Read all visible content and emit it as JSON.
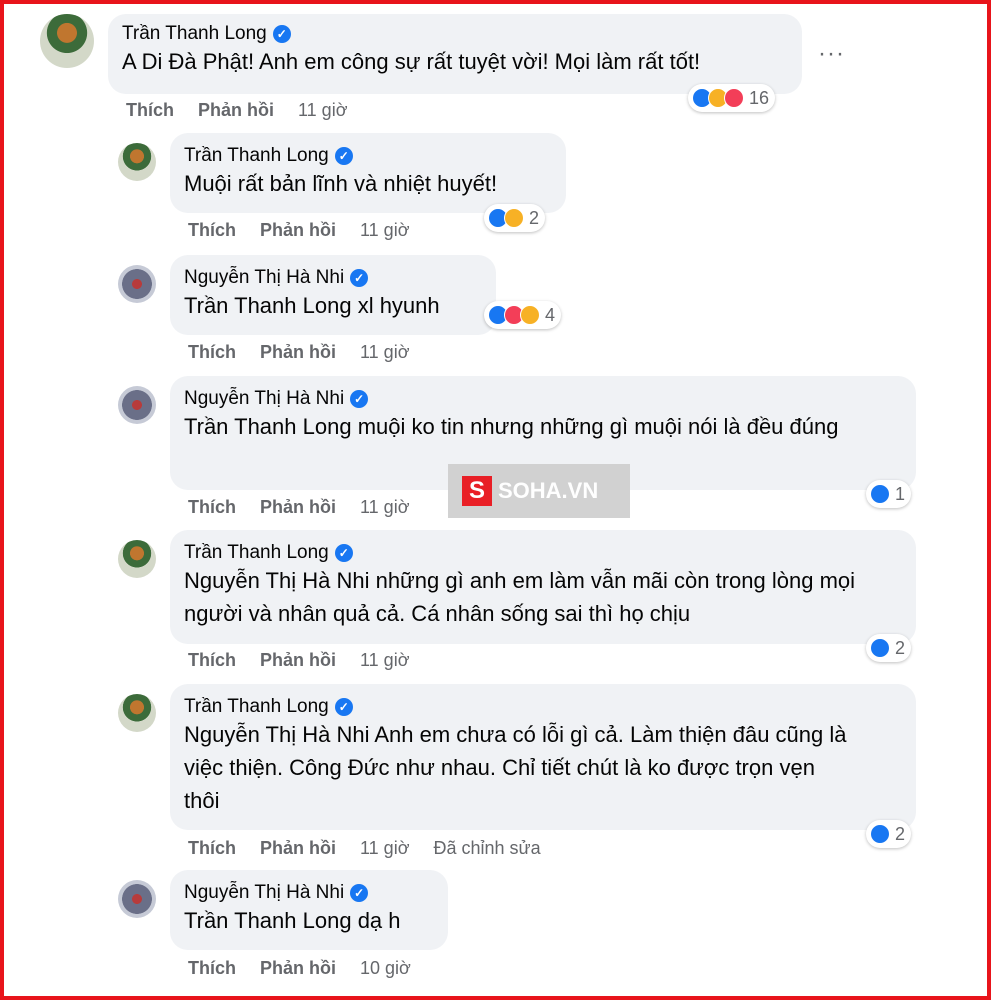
{
  "colors": {
    "border": "#e8141b",
    "bubble": "#f0f2f5",
    "meta": "#65676b",
    "like": "#1877f2"
  },
  "actions": {
    "like": "Thích",
    "reply": "Phản hồi"
  },
  "more_label": "···",
  "comments": [
    {
      "author": "Trần Thanh Long",
      "text": "A Di Đà Phật! Anh em công sự rất tuyệt vời! Mọi làm rất tốt!",
      "time": "11 giờ",
      "reactions": [
        "like",
        "care",
        "love"
      ],
      "count": "16"
    },
    {
      "author": "Trần Thanh Long",
      "text": "Muội rất bản lĩnh và nhiệt huyết!",
      "time": "11 giờ",
      "reactions": [
        "like",
        "care"
      ],
      "count": "2"
    },
    {
      "author": "Nguyễn Thị Hà Nhi",
      "tag": "Trần Thanh Long",
      "text": " xl hyunh",
      "time": "11 giờ",
      "reactions": [
        "like",
        "love",
        "sad"
      ],
      "count": "4"
    },
    {
      "author": "Nguyễn Thị Hà Nhi",
      "tag": "Trần Thanh Long",
      "text": " muội ko tin nhưng những gì muội nói là đều đúng",
      "time": "11 giờ",
      "reactions": [
        "like"
      ],
      "count": "1"
    },
    {
      "author": "Trần Thanh Long",
      "tag": "Nguyễn Thị Hà Nhi",
      "text": " những gì anh em làm vẫn mãi còn trong lòng mọi người và nhân quả cả. Cá nhân sống sai thì họ chịu",
      "time": "11 giờ",
      "reactions": [
        "like"
      ],
      "count": "2"
    },
    {
      "author": "Trần Thanh Long",
      "tag": "Nguyễn Thị Hà Nhi",
      "text": " Anh em chưa có lỗi gì cả. Làm thiện đâu cũng là việc thiện. Công Đức như nhau. Chỉ tiết chút là ko được trọn vẹn thôi",
      "time": "11 giờ",
      "edited": "Đã chỉnh sửa",
      "reactions": [
        "like"
      ],
      "count": "2"
    },
    {
      "author": "Nguyễn Thị Hà Nhi",
      "tag": "Trần Thanh Long",
      "text": " dạ h",
      "time": "10 giờ"
    }
  ],
  "watermark": {
    "logo": "S",
    "text": "SOHA.VN"
  }
}
